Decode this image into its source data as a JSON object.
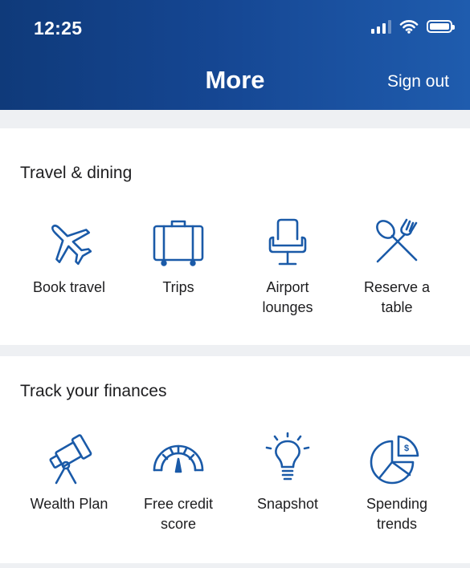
{
  "status_bar": {
    "time": "12:25"
  },
  "header": {
    "title": "More",
    "sign_out": "Sign out"
  },
  "sections": [
    {
      "title": "Travel & dining",
      "items": [
        {
          "label": "Book travel",
          "icon": "airplane-icon"
        },
        {
          "label": "Trips",
          "icon": "suitcase-icon"
        },
        {
          "label": "Airport lounges",
          "icon": "lounge-chair-icon"
        },
        {
          "label": "Reserve a table",
          "icon": "fork-spoon-icon"
        }
      ]
    },
    {
      "title": "Track your finances",
      "items": [
        {
          "label": "Wealth Plan",
          "icon": "telescope-icon"
        },
        {
          "label": "Free credit score",
          "icon": "gauge-icon"
        },
        {
          "label": "Snapshot",
          "icon": "lightbulb-icon"
        },
        {
          "label": "Spending trends",
          "icon": "pie-chart-dollar-icon"
        }
      ]
    }
  ],
  "colors": {
    "header_start": "#0f3a7a",
    "header_end": "#1f5cae",
    "icon": "#1a5aa8",
    "background": "#eef0f3"
  }
}
